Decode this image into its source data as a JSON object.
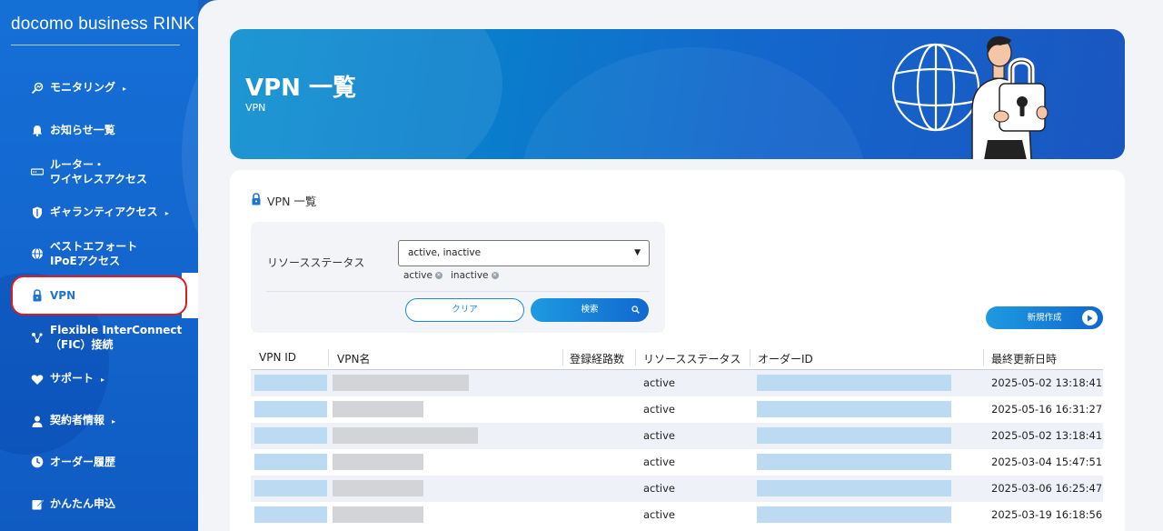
{
  "app": {
    "brand": "docomo business RINK"
  },
  "sidebar": {
    "items": [
      {
        "label": "モニタリング",
        "caret": "▸"
      },
      {
        "label": "お知らせ一覧"
      },
      {
        "label_line1": "ルーター・",
        "label_line2": "ワイヤレスアクセス"
      },
      {
        "label": "ギャランティアクセス",
        "caret": "▸"
      },
      {
        "label_line1": "ベストエフォート",
        "label_line2": "IPoEアクセス"
      },
      {
        "label": "VPN"
      },
      {
        "label_line1": "Flexible InterConnect",
        "label_line2": "（FIC）接続"
      },
      {
        "label": "サポート",
        "caret": "▸"
      },
      {
        "label": "契約者情報",
        "caret": "▸"
      },
      {
        "label": "オーダー履歴"
      },
      {
        "label": "かんたん申込"
      }
    ]
  },
  "header": {
    "title": "VPN 一覧",
    "subtitle": "VPN"
  },
  "content": {
    "section_title": "VPN 一覧",
    "filter": {
      "label": "リソースステータス",
      "selected": "active, inactive",
      "chips": [
        "active",
        "inactive"
      ],
      "clear_label": "クリア",
      "search_label": "検索"
    },
    "new_button": "新規作成"
  },
  "table": {
    "columns": [
      "VPN ID",
      "VPN名",
      "登録経路数",
      "リソースステータス",
      "オーダーID",
      "最終更新日時"
    ],
    "rows": [
      {
        "status": "active",
        "updated": "2025-05-02 13:18:41"
      },
      {
        "status": "active",
        "updated": "2025-05-16 16:31:27"
      },
      {
        "status": "active",
        "updated": "2025-05-02 13:18:41"
      },
      {
        "status": "active",
        "updated": "2025-03-04 15:47:51"
      },
      {
        "status": "active",
        "updated": "2025-03-06 16:25:47"
      },
      {
        "status": "active",
        "updated": "2025-03-19 16:18:56"
      }
    ]
  },
  "colors": {
    "sidebar": "#1468d0",
    "accent": "#1d8ad6",
    "active_outline": "#e0191e",
    "masked_id": "#bcdaf2",
    "masked_name": "#d2d4d8"
  }
}
